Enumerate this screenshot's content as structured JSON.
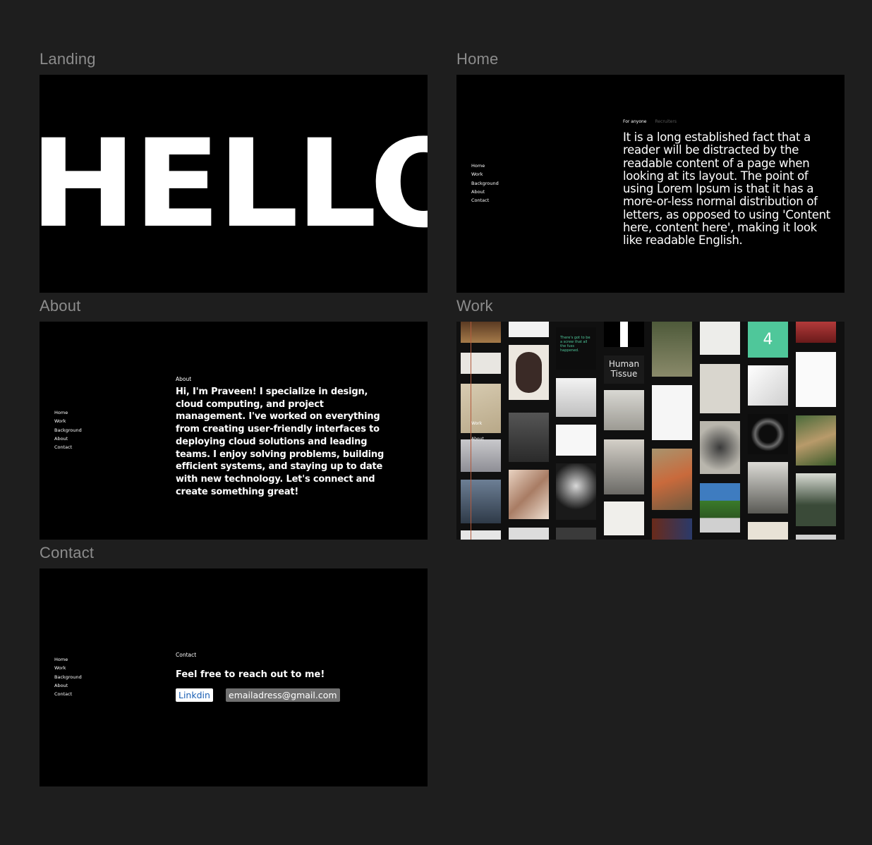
{
  "frames": {
    "landing": {
      "title": "Landing",
      "hero_text": "HELLO"
    },
    "home": {
      "title": "Home",
      "tabs": [
        "For anyone",
        "Recruiters"
      ],
      "body": "It is a long established fact that a reader will be distracted by the readable content of a page when looking at its layout. The point of using Lorem Ipsum is that it has a more-or-less normal distribution of letters, as opposed to using 'Content here, content here', making it look like readable English."
    },
    "about": {
      "title": "About",
      "section_label": "About",
      "body": "Hi, I'm Praveen! I specialize in design, cloud computing, and project management. I've worked on everything from creating user-friendly interfaces to deploying cloud solutions and leading teams. I enjoy solving problems, building efficient systems, and staying up to date with new technology. Let's connect and create something great!"
    },
    "work": {
      "title": "Work",
      "badge_number": "4",
      "overlay_labels": [
        "Work",
        "About"
      ],
      "tile_text": [
        "There's got to be a screw that all the fuss happened.",
        "Human Tissue"
      ]
    },
    "contact": {
      "title": "Contact",
      "section_label": "Contact",
      "heading": "Feel free to reach out to me!",
      "linkedin_label": "Linkdin",
      "email": "emailadress@gmail.com"
    }
  },
  "nav": [
    "Home",
    "Work",
    "Background",
    "About",
    "Contact"
  ],
  "colors": {
    "canvas": "#1e1e1e",
    "frame_bg": "#000000",
    "title_gray": "#8c8c8c",
    "linkedin_blue": "#1a5fb4",
    "badge_green": "#4fc79a",
    "accent_line": "#b45a3c"
  }
}
